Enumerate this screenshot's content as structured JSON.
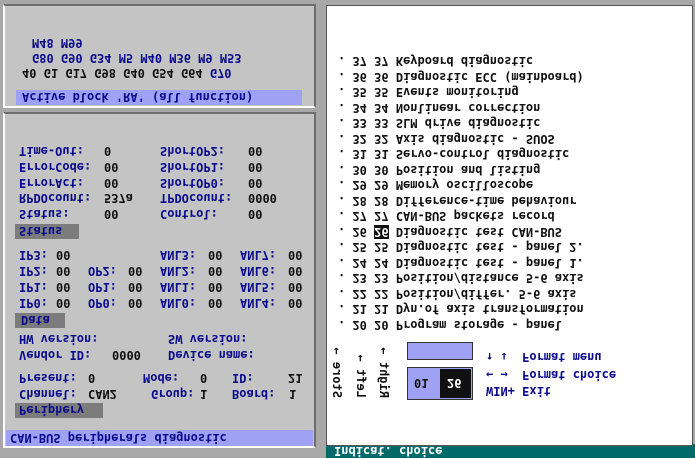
{
  "status_bar": {
    "text": "Indicat. choice"
  },
  "left_bottom_panel": {
    "title": "CAN-BUS peripherals diagnostic",
    "periphery": {
      "header": "Periphery",
      "channel_label": "Channel:",
      "channel": "CAN2",
      "group_label": "Group:",
      "group": "1",
      "board_label": "Board:",
      "board": "1",
      "present_label": "Present:",
      "present": "0",
      "mode_label": "Mode:",
      "mode": "0",
      "id_label": "ID:",
      "id": "21",
      "vendor_label": "Vendor ID:",
      "vendor": "0000",
      "device_label": "Device name:",
      "device": "",
      "hw_label": "HW version:",
      "hw": "",
      "sw_label": "SW version:",
      "sw": ""
    },
    "data": {
      "header": "Data",
      "rows": [
        {
          "a_label": "IP0:",
          "a": "00",
          "b_label": "OP0:",
          "b": "00",
          "c_label": "ANL0:",
          "c": "00",
          "d_label": "ANL4:",
          "d": "00"
        },
        {
          "a_label": "IP1:",
          "a": "00",
          "b_label": "OP1:",
          "b": "00",
          "c_label": "ANL1:",
          "c": "00",
          "d_label": "ANL5:",
          "d": "00"
        },
        {
          "a_label": "IP2:",
          "a": "00",
          "b_label": "OP2:",
          "b": "00",
          "c_label": "ANL2:",
          "c": "00",
          "d_label": "ANL6:",
          "d": "00"
        },
        {
          "a_label": "IP3:",
          "a": "00",
          "b_label": "",
          "b": "",
          "c_label": "ANL3:",
          "c": "00",
          "d_label": "ANL7:",
          "d": "00"
        }
      ]
    },
    "status": {
      "header": "Status",
      "rows": [
        {
          "l_label": "Status:",
          "l": "00",
          "r_label": "Control:",
          "r": "00"
        },
        {
          "l_label": "RPDOcount:",
          "l": "537a",
          "r_label": "TPDOcount:",
          "r": "0000"
        },
        {
          "l_label": "ErrorAct:",
          "l": "00",
          "r_label": "ShortOP0:",
          "r": "00"
        },
        {
          "l_label": "ErrorCode:",
          "l": "00",
          "r_label": "ShortOP1:",
          "r": "00"
        },
        {
          "l_label": "Time-Out:",
          "l": "0",
          "r_label": "ShortOP2:",
          "r": "00"
        }
      ]
    }
  },
  "left_top_panel": {
    "active_block": "Active block 'RA' (all function)",
    "line1_pre": "40 G1 G17 G98 G40 G54 G64 ",
    "line1_hl": "G70",
    "line2": "G80 G90 G34 M5 M40 M36 M9 M53",
    "line3": "M48 M99"
  },
  "menu": {
    "items": [
      {
        "a": "20",
        "b": "20",
        "label": "Program storage - panel"
      },
      {
        "a": "21",
        "b": "21",
        "label": "Dyn.of axis transformation"
      },
      {
        "a": "22",
        "b": "22",
        "label": "Position/differ. 5-6 axis"
      },
      {
        "a": "23",
        "b": "23",
        "label": "Position/distance 5-6 axis"
      },
      {
        "a": "24",
        "b": "24",
        "label": "Diagnostic test - panel 1."
      },
      {
        "a": "25",
        "b": "25",
        "label": "Diagnostic test - panel 2."
      },
      {
        "a": "26",
        "b": "26",
        "label": "Diagnostic test CAN-BUS",
        "selected": true
      },
      {
        "a": "27",
        "b": "27",
        "label": "CAN-BUS packets record"
      },
      {
        "a": "28",
        "b": "28",
        "label": "Difference-time behaviour"
      },
      {
        "a": "29",
        "b": "29",
        "label": "Memory oscilloscope"
      },
      {
        "a": "30",
        "b": "30",
        "label": "Position and listing"
      },
      {
        "a": "31",
        "b": "31",
        "label": "Servo-control diagnostic"
      },
      {
        "a": "32",
        "b": "32",
        "label": "Axis diagnostic - SUOS"
      },
      {
        "a": "33",
        "b": "33",
        "label": "SLM drive diagnostic"
      },
      {
        "a": "34",
        "b": "34",
        "label": "Nonlinear correction"
      },
      {
        "a": "35",
        "b": "35",
        "label": "Events monitoring"
      },
      {
        "a": "36",
        "b": "36",
        "label": "Diagnostic ECC (mainboard)"
      },
      {
        "a": "37",
        "b": "37",
        "label": "Keyboard diagnostic"
      }
    ],
    "selector": {
      "left": "01",
      "right": "26"
    },
    "keys": {
      "exit": "WIN+ Exit",
      "choice": "← →  Format choice",
      "menu": "↑ ↓  Format menu"
    },
    "vertical": [
      "Right →",
      "Left →",
      "Store →"
    ]
  }
}
